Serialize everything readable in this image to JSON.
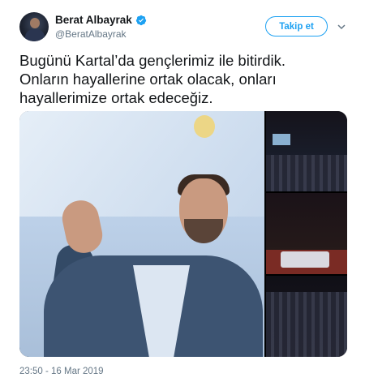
{
  "author": {
    "display_name": "Berat Albayrak",
    "handle": "@BeratAlbayrak",
    "verified": true
  },
  "actions": {
    "follow_label": "Takip et"
  },
  "tweet": {
    "text": "Bugünü Kartal’da gençlerimiz ile bitirdik.\nOnların hayallerine ortak olacak, onları\nhayallerimize ortak edeceğiz.",
    "timestamp": "23:50 - 16 Mar 2019"
  },
  "icons": {
    "verified": "verified-badge-icon",
    "caret": "chevron-down-icon"
  },
  "colors": {
    "accent": "#1da1f2",
    "text": "#14171a",
    "secondary_text": "#657786"
  }
}
